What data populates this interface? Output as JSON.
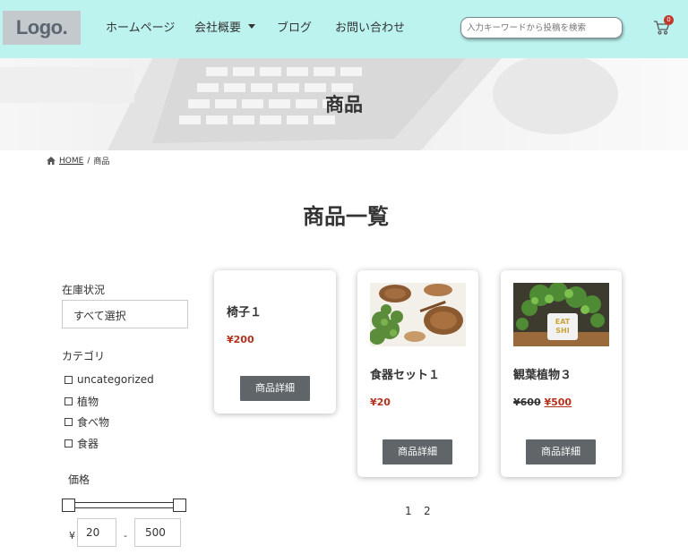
{
  "header": {
    "logo": "Logo.",
    "nav": [
      {
        "label": "ホームページ"
      },
      {
        "label": "会社概要"
      },
      {
        "label": "ブログ"
      },
      {
        "label": "お問い合わせ"
      }
    ],
    "search_placeholder": "入力キーワードから投稿を検索",
    "cart_count": "0"
  },
  "hero": {
    "title": "商品"
  },
  "breadcrumb": {
    "home": "HOME",
    "separator": "/",
    "current": "商品"
  },
  "page_title": "商品一覧",
  "sidebar": {
    "stock_label": "在庫状況",
    "stock_value": "すべて選択",
    "category_label": "カテゴリ",
    "categories": [
      {
        "label": "uncategorized"
      },
      {
        "label": "植物"
      },
      {
        "label": "食べ物"
      },
      {
        "label": "食器"
      }
    ],
    "price_label": "価格",
    "currency": "¥",
    "price_min": "20",
    "price_sep": "-",
    "price_max": "500"
  },
  "products": [
    {
      "name": "椅子１",
      "price": "¥200",
      "button": "商品詳細"
    },
    {
      "name": "食器セット１",
      "price": "¥20",
      "button": "商品詳細"
    },
    {
      "name": "観葉植物３",
      "old_price": "¥600",
      "price": "¥500",
      "button": "商品詳細"
    }
  ],
  "pagination": [
    "1",
    "2"
  ],
  "colors": {
    "header_bg": "#bdf3ef",
    "price_red": "#b5311e",
    "button_bg": "#5f6568"
  }
}
